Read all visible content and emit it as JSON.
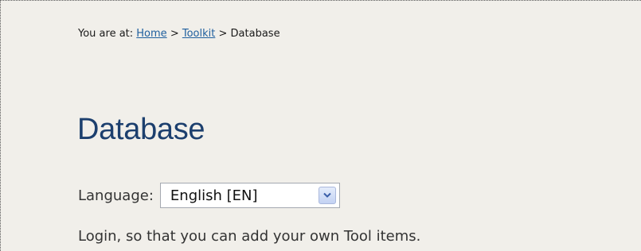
{
  "breadcrumb": {
    "prefix": "You are at:",
    "items": [
      {
        "label": "Home",
        "link": true
      },
      {
        "label": "Toolkit",
        "link": true
      },
      {
        "label": "Database",
        "link": false
      }
    ],
    "separator": ">"
  },
  "page": {
    "title": "Database"
  },
  "language": {
    "label": "Language:",
    "selected": "English [EN]",
    "dropdown_icon": "chevron-down-icon"
  },
  "login_message": "Login, so that you can add your own Tool items.",
  "colors": {
    "background": "#f1efea",
    "link": "#1f5f9e",
    "title": "#1c3f6e"
  }
}
